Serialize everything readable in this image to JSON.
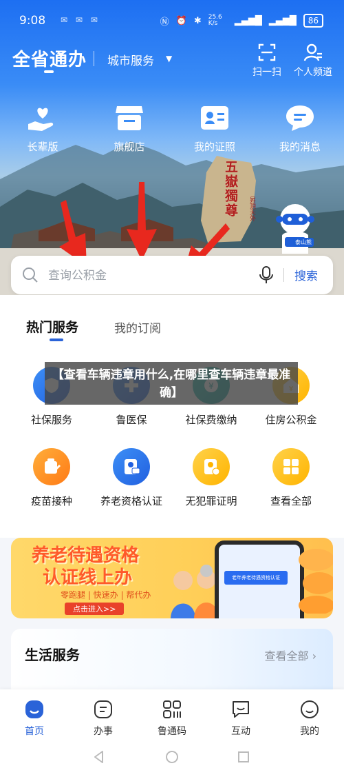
{
  "status": {
    "time": "9:08",
    "left_icons": "✉ ✉ ✉",
    "net_speed": "25.6 K/s",
    "battery": "86"
  },
  "header": {
    "app_title": "全省通办",
    "city_service": "城市服务",
    "caret": "▼",
    "scan_label": "扫一扫",
    "profile_label": "个人频道"
  },
  "quick": [
    {
      "label": "长辈版",
      "icon": "heart-hand-icon"
    },
    {
      "label": "旗舰店",
      "icon": "store-icon"
    },
    {
      "label": "我的证照",
      "icon": "id-card-icon"
    },
    {
      "label": "我的消息",
      "icon": "message-icon"
    }
  ],
  "hero": {
    "stone_text": "五嶽獨尊",
    "stone_small": "昇頂天外",
    "mascot_label": "泰山熊"
  },
  "search": {
    "placeholder": "查询公积金",
    "button": "搜索"
  },
  "tabs": {
    "hot": "热门服务",
    "subscribed": "我的订阅"
  },
  "services_row1": [
    {
      "label": "社保服务",
      "icon": "shield-icon"
    },
    {
      "label": "鲁医保",
      "icon": "medical-insurance-icon"
    },
    {
      "label": "社保费缴纳",
      "icon": "payment-icon"
    },
    {
      "label": "住房公积金",
      "icon": "housing-fund-icon"
    }
  ],
  "services_row2": [
    {
      "label": "疫苗接种",
      "icon": "vaccine-icon"
    },
    {
      "label": "养老资格认证",
      "icon": "pension-cert-icon"
    },
    {
      "label": "无犯罪证明",
      "icon": "certificate-icon"
    },
    {
      "label": "查看全部",
      "icon": "grid-icon"
    }
  ],
  "overlay": {
    "text": "【查看车辆违章用什么,在哪里查车辆违章最准确】"
  },
  "banner": {
    "title_line1": "养老待遇资格",
    "title_line2": "认证线上办",
    "tags": "零跑腿 | 快速办 | 帮代办",
    "cta": "点击进入>>",
    "phone_text": "老年养老待遇资格认证"
  },
  "life": {
    "title": "生活服务",
    "more": "查看全部 ›"
  },
  "bottom_nav": [
    {
      "label": "首页",
      "icon": "home-icon",
      "active": true
    },
    {
      "label": "办事",
      "icon": "task-icon",
      "active": false
    },
    {
      "label": "鲁通码",
      "icon": "qr-code-icon",
      "active": false
    },
    {
      "label": "互动",
      "icon": "chat-icon",
      "active": false
    },
    {
      "label": "我的",
      "icon": "smile-icon",
      "active": false
    }
  ],
  "colors": {
    "primary": "#2a63d8",
    "arrow_red": "#e8281e",
    "hero_blue": "#1d6ff2"
  }
}
